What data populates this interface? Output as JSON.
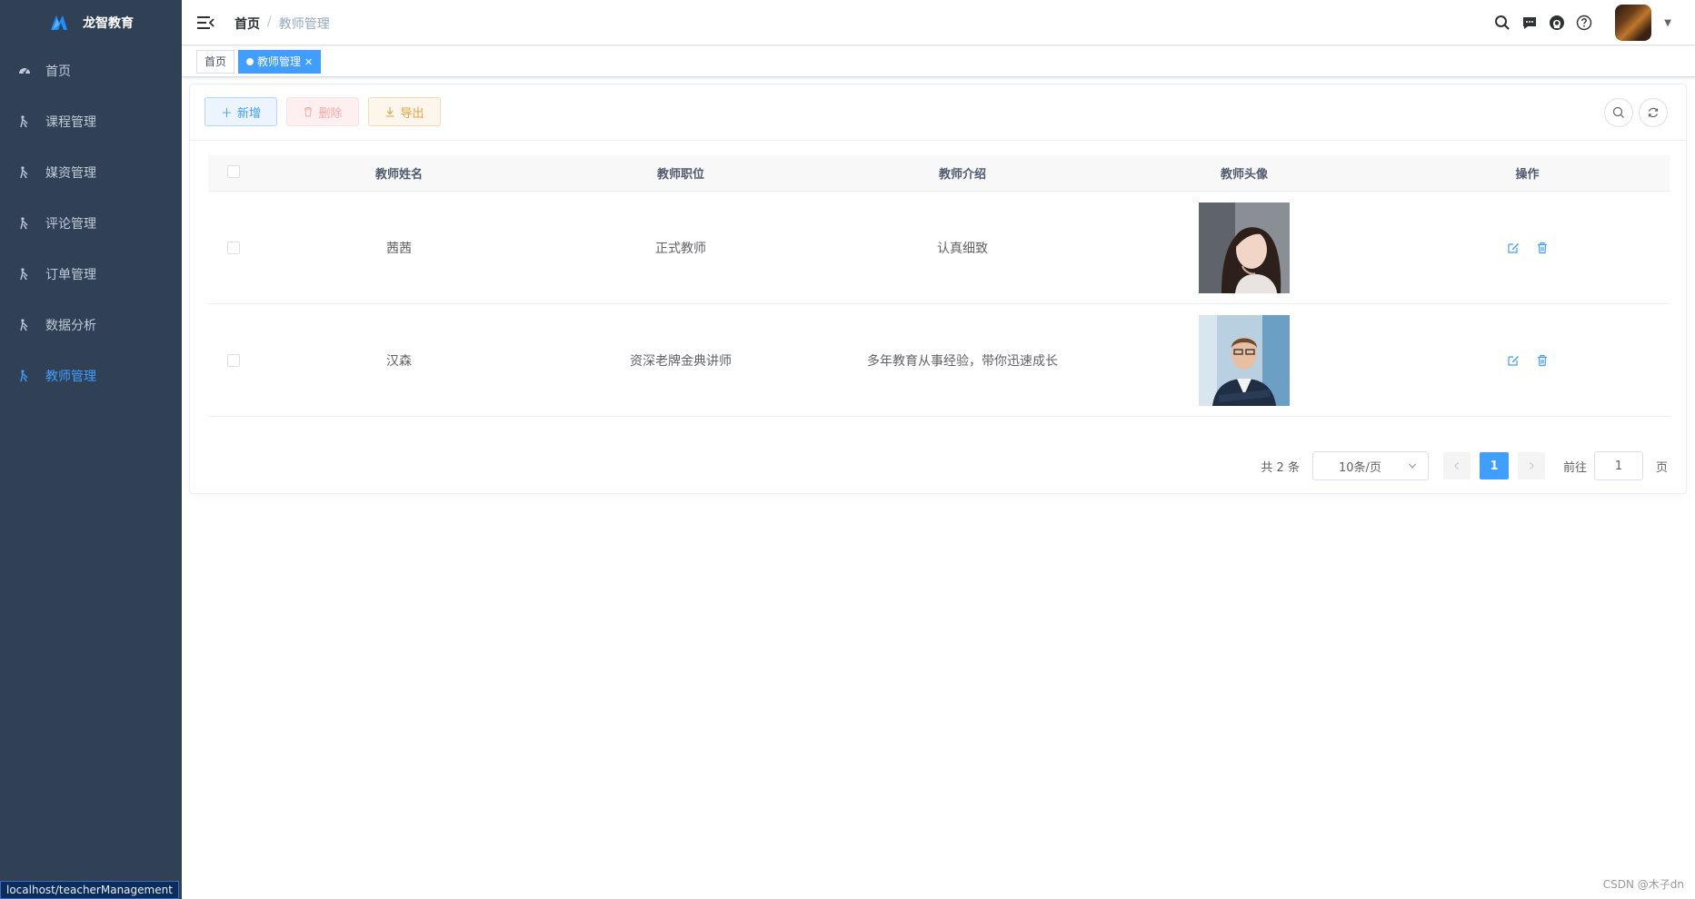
{
  "sidebar": {
    "logo_text": "龙智教育",
    "items": [
      {
        "label": "首页",
        "icon": "dashboard-icon",
        "active": false
      },
      {
        "label": "课程管理",
        "icon": "person-icon",
        "active": false
      },
      {
        "label": "媒资管理",
        "icon": "person-icon",
        "active": false
      },
      {
        "label": "评论管理",
        "icon": "person-icon",
        "active": false
      },
      {
        "label": "订单管理",
        "icon": "person-icon",
        "active": false
      },
      {
        "label": "数据分析",
        "icon": "person-icon",
        "active": false
      },
      {
        "label": "教师管理",
        "icon": "person-icon",
        "active": true
      }
    ],
    "status_url": "localhost/teacherManagement"
  },
  "navbar": {
    "breadcrumb_home": "首页",
    "breadcrumb_sep": "/",
    "breadcrumb_current": "教师管理"
  },
  "tags": {
    "home": "首页",
    "current": "教师管理"
  },
  "toolbar": {
    "add_label": "新增",
    "delete_label": "删除",
    "export_label": "导出"
  },
  "table": {
    "columns": [
      "教师姓名",
      "教师职位",
      "教师介绍",
      "教师头像",
      "操作"
    ],
    "rows": [
      {
        "name": "茜茜",
        "position": "正式教师",
        "intro": "认真细致"
      },
      {
        "name": "汉森",
        "position": "资深老牌金典讲师",
        "intro": "多年教育从事经验，带你迅速成长"
      }
    ]
  },
  "pagination": {
    "total_text": "共 2 条",
    "page_size": "10条/页",
    "current_page": "1",
    "goto_label": "前往",
    "goto_value": "1",
    "page_suffix": "页"
  },
  "watermark": "CSDN @木子dn",
  "colors": {
    "sidebar_bg": "#304156",
    "primary": "#409eff",
    "danger_light": "#fef0f0",
    "warning": "#e6a23c"
  }
}
